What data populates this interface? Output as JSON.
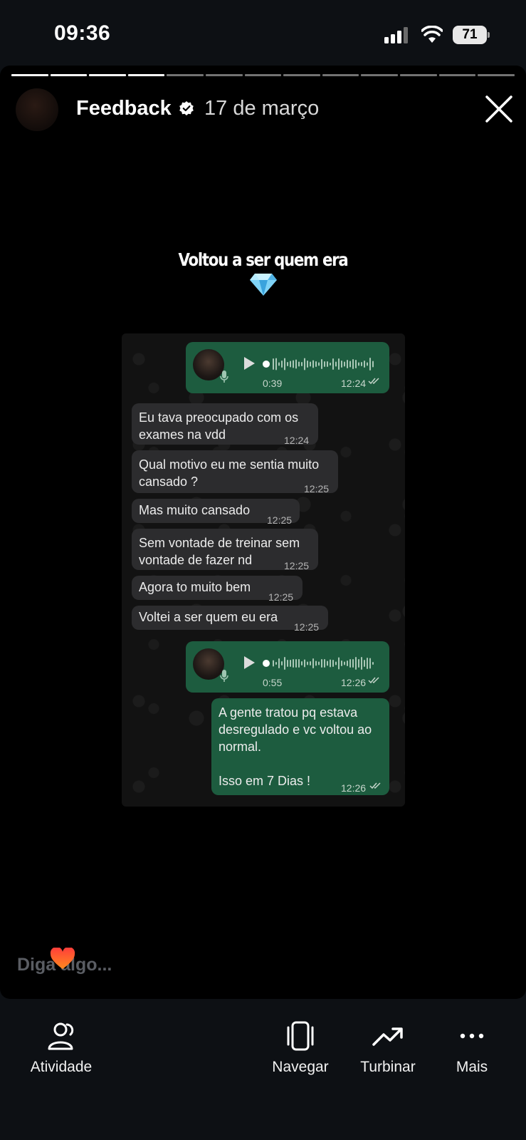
{
  "status_bar": {
    "time": "09:36",
    "battery": "71"
  },
  "story": {
    "progress_segments": 13,
    "progress_done": 4,
    "account_name": "Feedback",
    "date": "17 de março",
    "caption": "Voltou a ser quem era"
  },
  "chat": {
    "voice_1": {
      "duration": "0:39",
      "time": "12:24"
    },
    "messages": [
      {
        "text": "Eu tava preocupado com os\nexames na vdd",
        "time": "12:24"
      },
      {
        "text": "Qual motivo eu me sentia muito\ncansado ?",
        "time": "12:25"
      },
      {
        "text": "Mas muito cansado",
        "time": "12:25"
      },
      {
        "text": "Sem vontade de treinar sem\nvontade de fazer nd",
        "time": "12:25"
      },
      {
        "text": "Agora to muito bem",
        "time": "12:25"
      },
      {
        "text": "Voltei a ser quem eu era",
        "time": "12:25"
      }
    ],
    "voice_2": {
      "duration": "0:55",
      "time": "12:26"
    },
    "reply": {
      "text": "A gente tratou pq estava\ndesregulado e vc voltou ao\nnormal.\n\nIsso em 7 Dias !",
      "time": "12:26"
    }
  },
  "comment": {
    "placeholder": "Diga algo..."
  },
  "bottom_nav": {
    "activity": "Atividade",
    "browse": "Navegar",
    "boost": "Turbinar",
    "more": "Mais"
  },
  "icons": {
    "verified": "verified-badge-icon",
    "close": "close-icon",
    "diamond": "gem-emoji-icon",
    "heart": "heart-emoji-icon",
    "activity": "people-icon",
    "browse": "phone-frame-icon",
    "boost": "trending-up-icon",
    "more": "more-dots-icon"
  },
  "colors": {
    "outgoing_bubble": "#1d5c3f",
    "incoming_bubble": "#2c2c2e",
    "background": "#000000"
  }
}
